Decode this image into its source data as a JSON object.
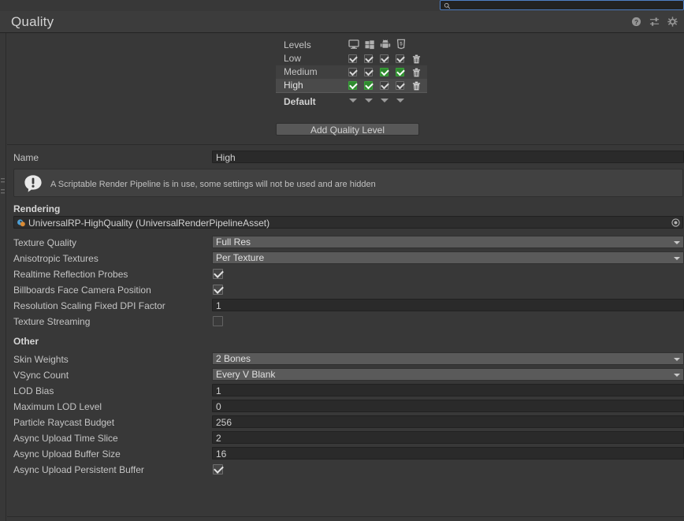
{
  "search": {
    "value": "",
    "placeholder": "",
    "icon": "search-icon"
  },
  "header": {
    "title": "Quality",
    "icons": [
      {
        "name": "help-icon",
        "label": "?"
      },
      {
        "name": "preset-icon",
        "label": "presets"
      },
      {
        "name": "gear-icon",
        "label": "settings"
      }
    ]
  },
  "levels": {
    "header_label": "Levels",
    "platforms": [
      {
        "name": "standalone-icon",
        "label": "Standalone"
      },
      {
        "name": "windows-store-icon",
        "label": "Universal Windows Platform"
      },
      {
        "name": "android-icon",
        "label": "Android"
      },
      {
        "name": "webgl-icon",
        "label": "WebGL"
      }
    ],
    "rows": [
      {
        "label": "Low",
        "selected": false,
        "alt": false,
        "checks": [
          "on",
          "on",
          "on",
          "on"
        ],
        "delete_icon": "trash-icon"
      },
      {
        "label": "Medium",
        "selected": false,
        "alt": true,
        "checks": [
          "on",
          "on",
          "green",
          "green"
        ],
        "delete_icon": "trash-icon"
      },
      {
        "label": "High",
        "selected": true,
        "alt": false,
        "checks": [
          "green",
          "green",
          "on",
          "on"
        ],
        "delete_icon": "trash-icon"
      }
    ],
    "default_label": "Default",
    "default_arrows": 4,
    "add_button": "Add Quality Level"
  },
  "name_row": {
    "label": "Name",
    "value": "High"
  },
  "info": {
    "icon": "info-exclamation-icon",
    "message": "A Scriptable Render Pipeline is in use, some settings will not be used and are hidden"
  },
  "rendering": {
    "section_title": "Rendering",
    "asset": {
      "name": "UniversalRP-HighQuality (UniversalRenderPipelineAsset)",
      "icon": "render-pipeline-asset-icon",
      "picker_icon": "object-picker-icon"
    },
    "fields": [
      {
        "label": "Texture Quality",
        "type": "popup",
        "value": "Full Res"
      },
      {
        "label": "Anisotropic Textures",
        "type": "popup",
        "value": "Per Texture"
      },
      {
        "label": "Realtime Reflection Probes",
        "type": "toggle",
        "value": true
      },
      {
        "label": "Billboards Face Camera Position",
        "type": "toggle",
        "value": true
      },
      {
        "label": "Resolution Scaling Fixed DPI Factor",
        "type": "text",
        "value": "1"
      },
      {
        "label": "Texture Streaming",
        "type": "toggle",
        "value": false
      }
    ]
  },
  "other": {
    "section_title": "Other",
    "fields": [
      {
        "label": "Skin Weights",
        "type": "popup",
        "value": "2 Bones"
      },
      {
        "label": "VSync Count",
        "type": "popup",
        "value": "Every V Blank"
      },
      {
        "label": "LOD Bias",
        "type": "text",
        "value": "1"
      },
      {
        "label": "Maximum LOD Level",
        "type": "text",
        "value": "0"
      },
      {
        "label": "Particle Raycast Budget",
        "type": "text",
        "value": "256"
      },
      {
        "label": "Async Upload Time Slice",
        "type": "text",
        "value": "2"
      },
      {
        "label": "Async Upload Buffer Size",
        "type": "text",
        "value": "16"
      },
      {
        "label": "Async Upload Persistent Buffer",
        "type": "toggle",
        "value": true
      }
    ]
  },
  "colors": {
    "background": "#383838",
    "panel": "#3c3c3c",
    "field": "#2a2a2a",
    "popup": "#5a5a5a",
    "accent_green": "#2f8a2f",
    "focus_blue": "#4e7fc4",
    "text": "#c4c4c4"
  }
}
